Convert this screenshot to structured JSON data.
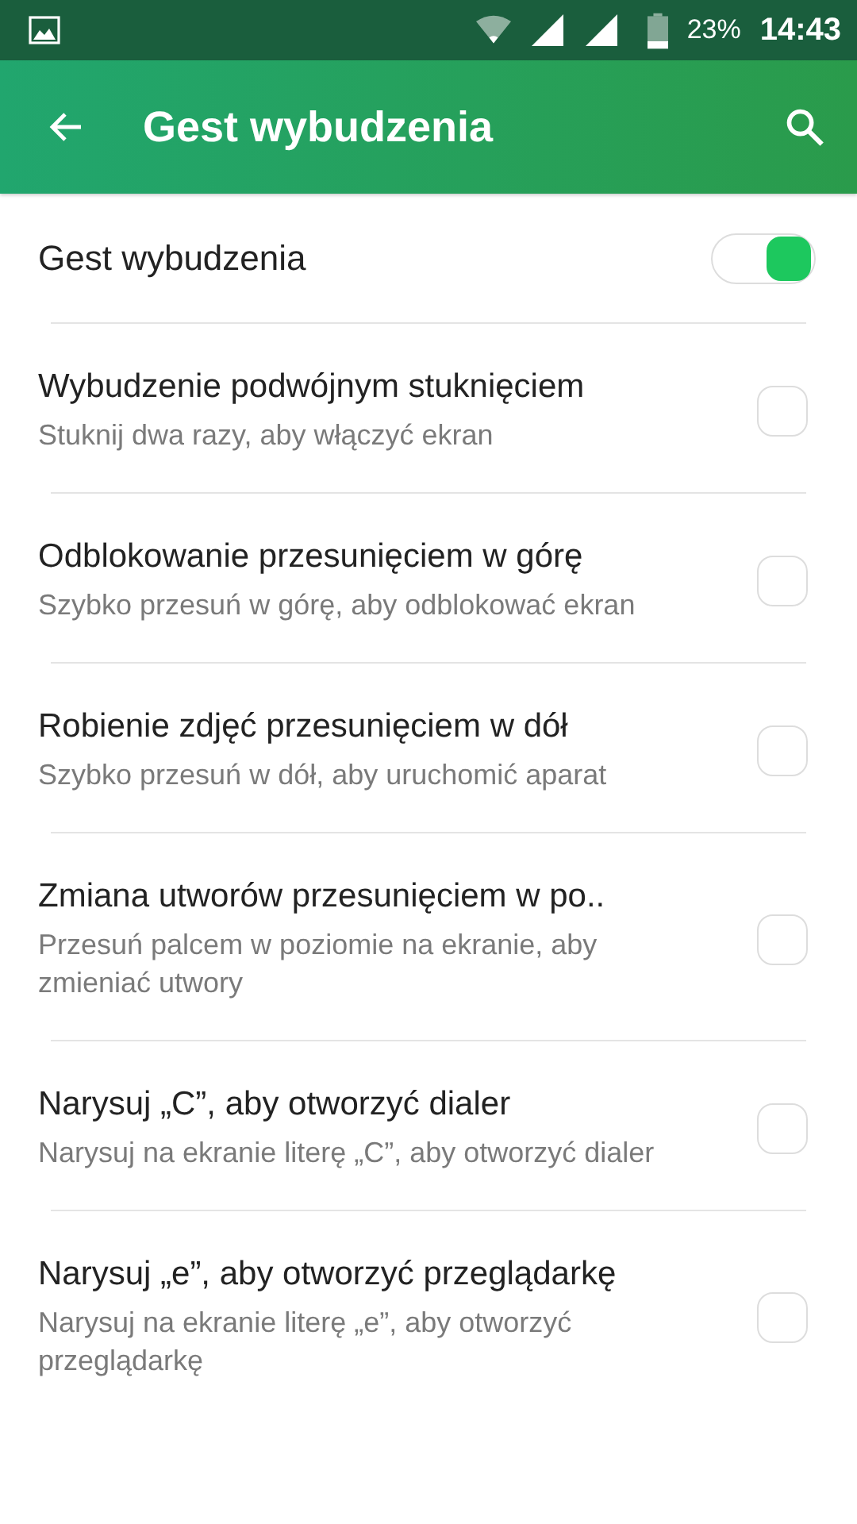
{
  "status_bar": {
    "battery": "23%",
    "time": "14:43"
  },
  "toolbar": {
    "title": "Gest wybudzenia"
  },
  "master": {
    "label": "Gest wybudzenia",
    "on": true
  },
  "items": [
    {
      "title": "Wybudzenie podwójnym stuknięciem",
      "subtitle": "Stuknij dwa razy, aby włączyć ekran",
      "checked": false
    },
    {
      "title": "Odblokowanie przesunięciem w górę",
      "subtitle": "Szybko przesuń w górę, aby odblokować ekran",
      "checked": false
    },
    {
      "title": "Robienie zdjęć przesunięciem w dół",
      "subtitle": "Szybko przesuń w dół, aby uruchomić aparat",
      "checked": false
    },
    {
      "title": "Zmiana utworów przesunięciem w po..",
      "subtitle": "Przesuń palcem w poziomie na ekranie, aby zmieniać utwory",
      "checked": false
    },
    {
      "title": "Narysuj „C”, aby otworzyć dialer",
      "subtitle": "Narysuj na ekranie literę „C”, aby otworzyć dialer",
      "checked": false
    },
    {
      "title": "Narysuj „e”, aby otworzyć przeglądarkę",
      "subtitle": "Narysuj na ekranie literę „e”, aby otworzyć przeglądarkę",
      "checked": false
    }
  ]
}
